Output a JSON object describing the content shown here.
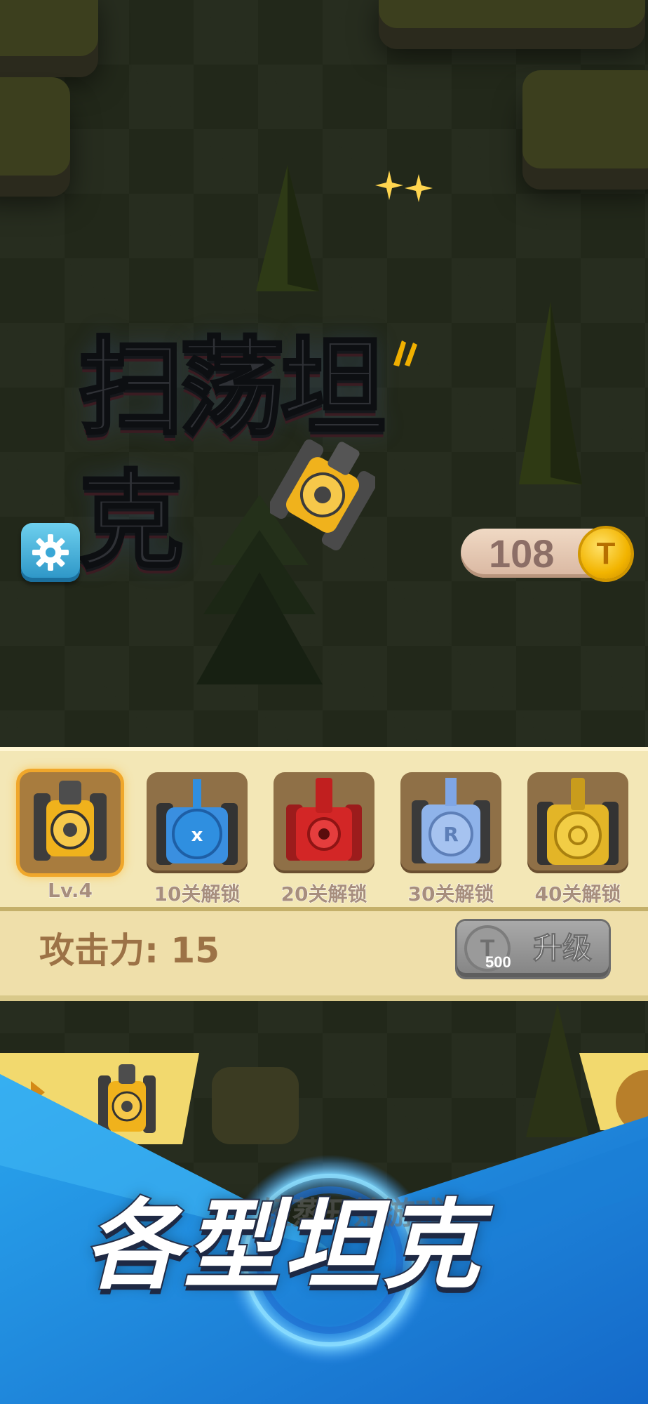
{
  "game": {
    "title": "扫荡坦克",
    "coins": "108",
    "coin_symbol": "T"
  },
  "tank_select": {
    "tanks": [
      {
        "label": "Lv.4",
        "color": "#f2b400",
        "selected": true
      },
      {
        "label": "10关解锁",
        "color": "#2f8fe0",
        "selected": false
      },
      {
        "label": "20关解锁",
        "color": "#d32626",
        "selected": false
      },
      {
        "label": "30关解锁",
        "color": "#7fa6e6",
        "selected": false
      },
      {
        "label": "40关解锁",
        "color": "#e3b527",
        "selected": false
      }
    ],
    "attack_label": "攻击力: 15",
    "upgrade": {
      "label": "升级",
      "price": "500",
      "coin_symbol": "T"
    }
  },
  "promo": {
    "banner_text": "各型坦克",
    "partial_hint": "轻蒸开始游戏"
  },
  "icons": [
    "gear-icon",
    "coin-icon",
    "tank-icon"
  ]
}
